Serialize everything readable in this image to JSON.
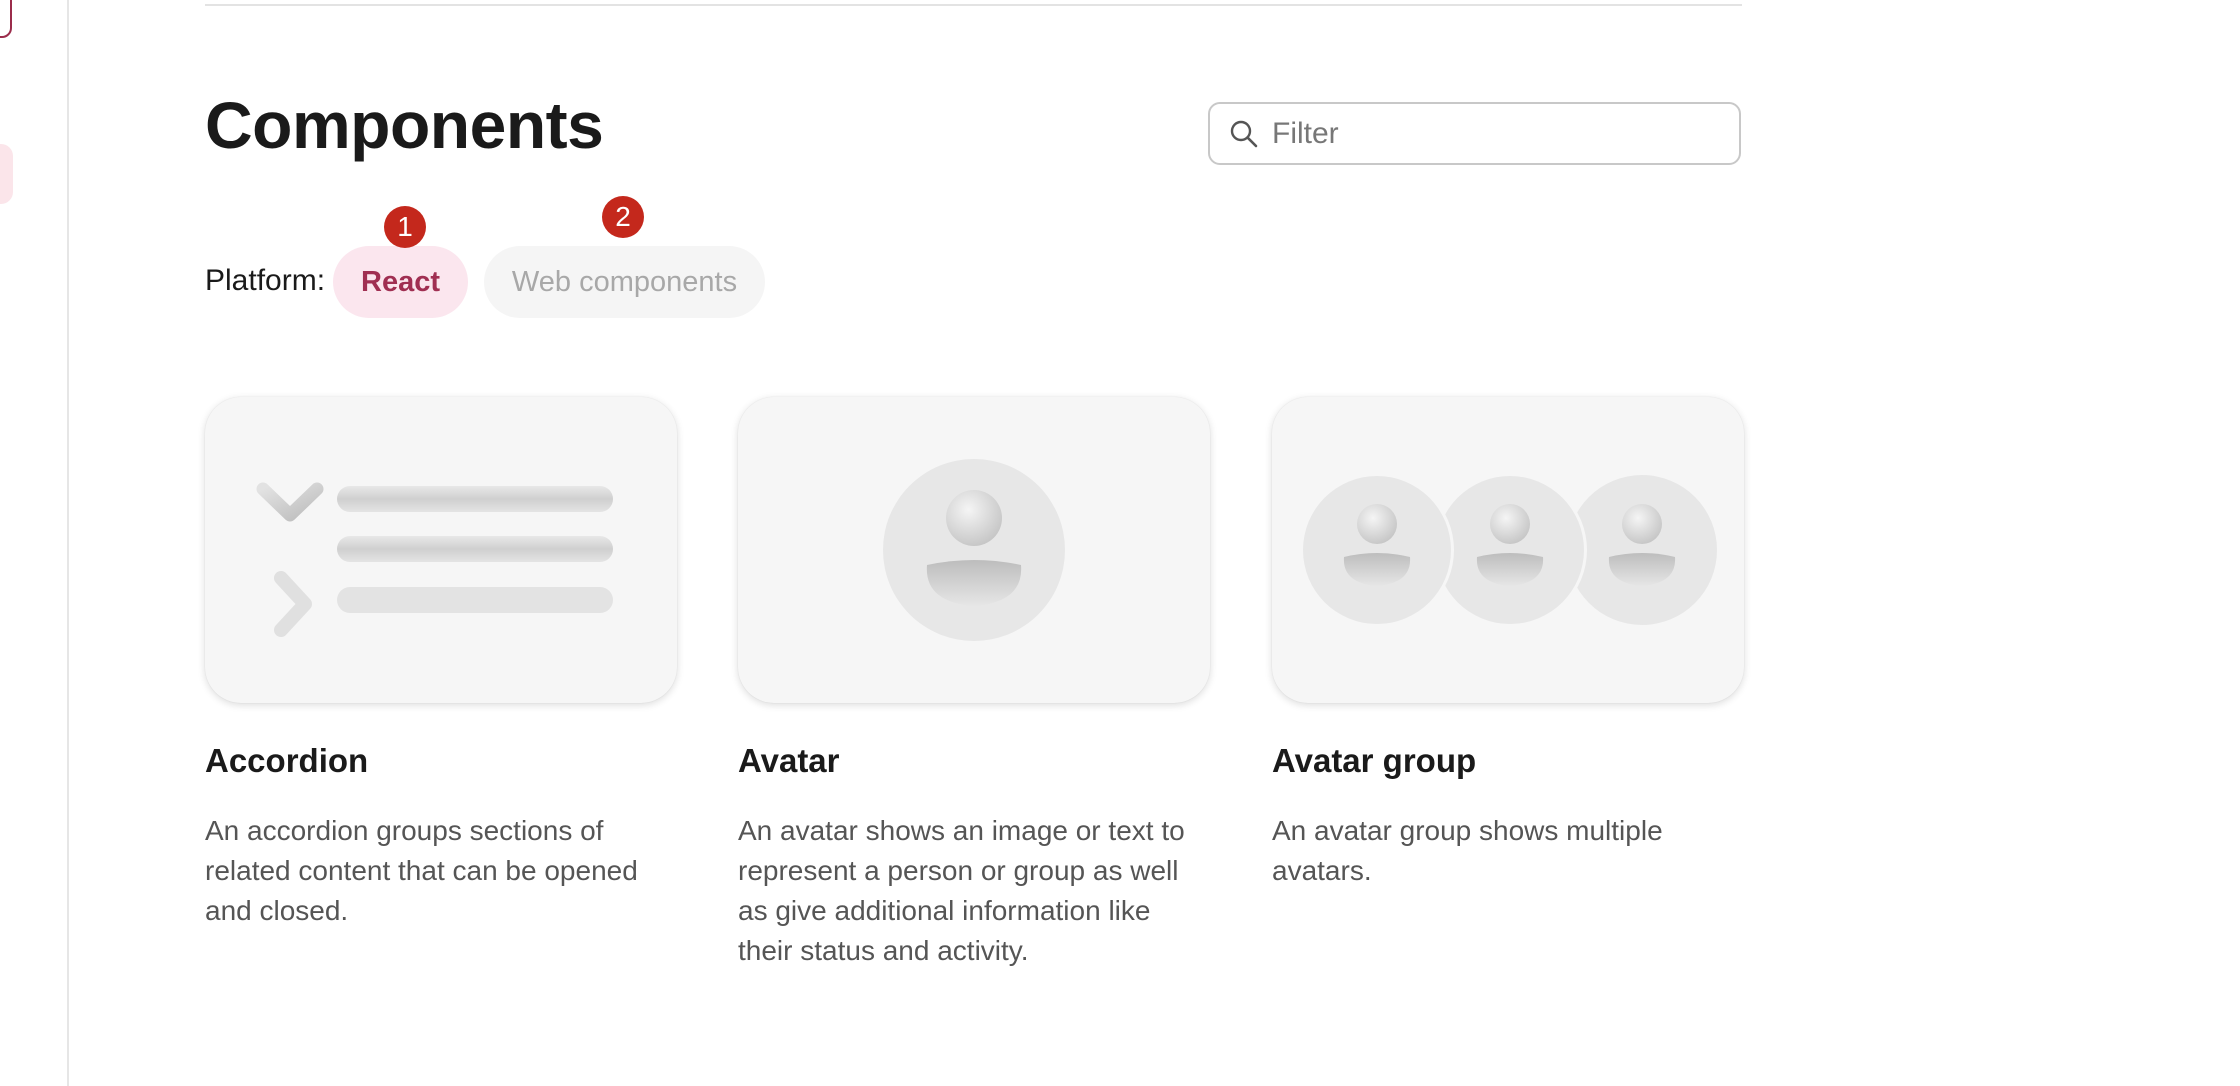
{
  "page": {
    "title": "Components"
  },
  "filter": {
    "placeholder": "Filter"
  },
  "platform": {
    "label": "Platform:",
    "options": [
      {
        "label": "React",
        "selected": true,
        "badge": "1"
      },
      {
        "label": "Web components",
        "selected": false,
        "badge": "2"
      }
    ]
  },
  "cards": [
    {
      "title": "Accordion",
      "description": "An accordion groups sections of related content that can be opened and closed.",
      "illustration": "accordion-icon"
    },
    {
      "title": "Avatar",
      "description": "An avatar shows an image or text to represent a person or group as well as give additional information like their status and activity.",
      "illustration": "avatar-icon"
    },
    {
      "title": "Avatar group",
      "description": "An avatar group shows multiple avatars.",
      "illustration": "avatar-group-icon"
    }
  ],
  "colors": {
    "accent": "#a02f52",
    "accent_bg": "#fbe6ee",
    "badge": "#c4281c"
  }
}
